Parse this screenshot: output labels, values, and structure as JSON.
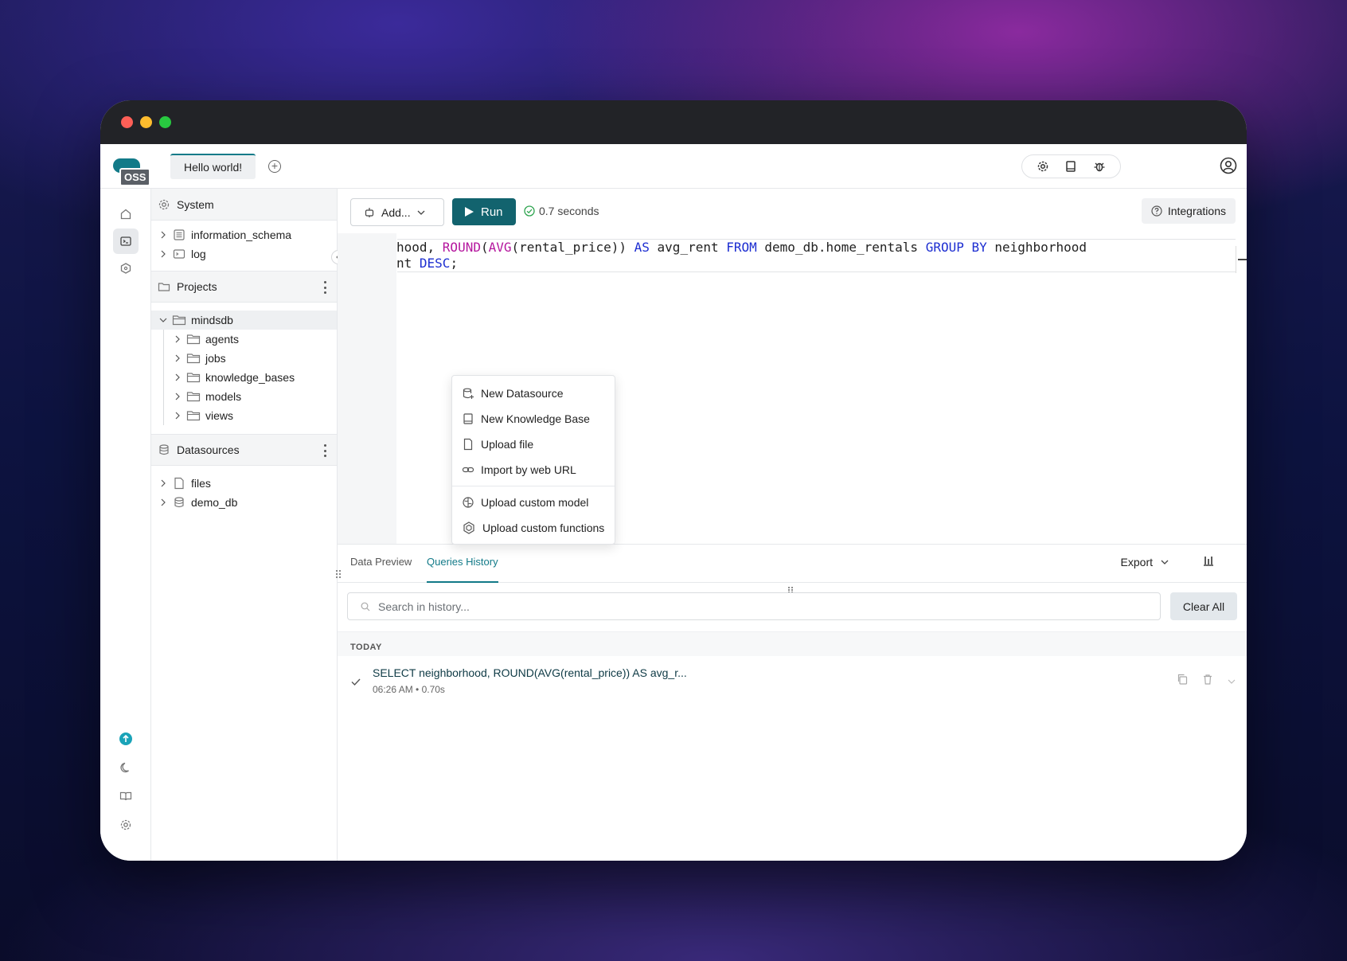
{
  "app": {
    "logo_badge": "OSS",
    "tab_title": "Hello world!"
  },
  "tree": {
    "system_label": "System",
    "system_items": [
      {
        "label": "information_schema",
        "icon": "table-icon"
      },
      {
        "label": "log",
        "icon": "terminal-icon"
      }
    ],
    "projects_label": "Projects",
    "project": {
      "label": "mindsdb",
      "children": [
        "agents",
        "jobs",
        "knowledge_bases",
        "models",
        "views"
      ]
    },
    "datasources_label": "Datasources",
    "datasources": [
      {
        "label": "files",
        "icon": "file-icon"
      },
      {
        "label": "demo_db",
        "icon": "database-icon"
      }
    ]
  },
  "toolbar": {
    "add_label": "Add...",
    "run_label": "Run",
    "status_text": "0.7 seconds",
    "integrations_label": "Integrations"
  },
  "editor": {
    "line1": {
      "a": "hood, ",
      "fn1": "ROUND",
      "b": "(",
      "fn2": "AVG",
      "c": "(rental_price)) ",
      "kw1": "AS",
      "d": " avg_rent ",
      "kw2": "FROM",
      "e": " demo_db.home_rentals ",
      "kw3": "GROUP BY",
      "f": " neighborhood"
    },
    "line2": {
      "a": "nt ",
      "kw1": "DESC",
      "b": ";"
    }
  },
  "add_menu": {
    "items": [
      {
        "label": "New Datasource",
        "icon": "database-plus-icon"
      },
      {
        "label": "New Knowledge Base",
        "icon": "book-icon"
      },
      {
        "label": "Upload file",
        "icon": "file-icon"
      },
      {
        "label": "Import by web URL",
        "icon": "link-icon"
      }
    ],
    "items2": [
      {
        "label": "Upload custom model",
        "icon": "brain-icon"
      },
      {
        "label": "Upload custom functions",
        "icon": "hexagon-icon"
      }
    ]
  },
  "results": {
    "tabs": [
      "Data Preview",
      "Queries History"
    ],
    "active_tab": "Queries History",
    "export_label": "Export",
    "search_placeholder": "Search in history...",
    "clear_label": "Clear All",
    "day_label": "TODAY",
    "history": [
      {
        "query": "SELECT neighborhood, ROUND(AVG(rental_price)) AS avg_r...",
        "meta": "06:26 AM • 0.70s",
        "status": "success"
      }
    ]
  },
  "colors": {
    "accent": "#127a88",
    "run_button": "#12636e",
    "keyword": "#1d2ed1",
    "function": "#b5179e"
  }
}
